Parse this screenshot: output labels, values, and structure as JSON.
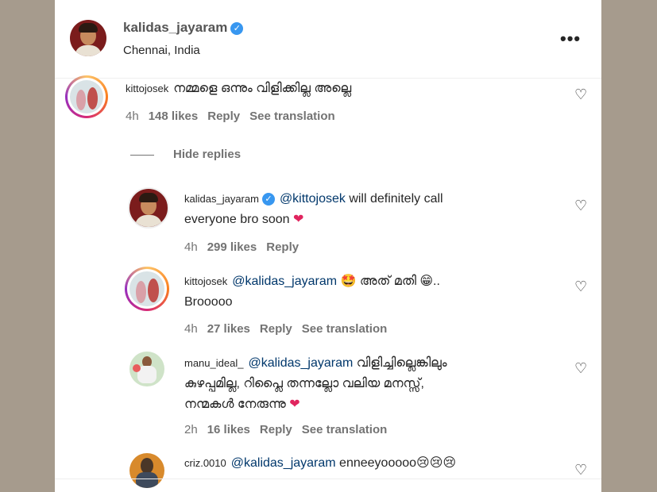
{
  "post": {
    "username": "kalidas_jayaram",
    "location": "Chennai, India",
    "verified_icon": "verified-badge-icon",
    "more_icon": "more-options-icon"
  },
  "comments": [
    {
      "username": "kittojosek",
      "text": "നമ്മളെ ഒന്നും വിളിക്കില്ല അല്ലെ ",
      "time": "4h",
      "likes": "148 likes",
      "reply": "Reply",
      "translate": "See translation"
    }
  ],
  "hide_replies": "Hide replies",
  "replies": [
    {
      "username": "kalidas_jayaram",
      "mention": "@kittojosek",
      "text1": " will definitely call",
      "text2": "everyone bro soon ",
      "emoji": "❤",
      "time": "4h",
      "likes": "299 likes",
      "reply": "Reply"
    },
    {
      "username": "kittojosek",
      "mention": "@kalidas_jayaram",
      "text1": " 🤩 അത് മതി 😁..",
      "text2": "Brooooo",
      "time": "4h",
      "likes": "27 likes",
      "reply": "Reply",
      "translate": "See translation"
    },
    {
      "username": "manu_ideal_",
      "mention": "@kalidas_jayaram",
      "text1": " വിളിച്ചില്ലെങ്കിലും",
      "text2": "കുഴപ്പമില്ല, റിപ്ലൈ തന്നല്ലോ വലിയ മനസ്സ്,",
      "text3": "നന്മകൾ നേരുന്നു ",
      "emoji": "❤",
      "time": "2h",
      "likes": "16 likes",
      "reply": "Reply",
      "translate": "See translation"
    },
    {
      "username": "criz.0010",
      "mention": "@kalidas_jayaram",
      "text1": " enneeyooooo😢😢😢"
    }
  ],
  "icons": {
    "heart": "heart-outline-icon"
  }
}
